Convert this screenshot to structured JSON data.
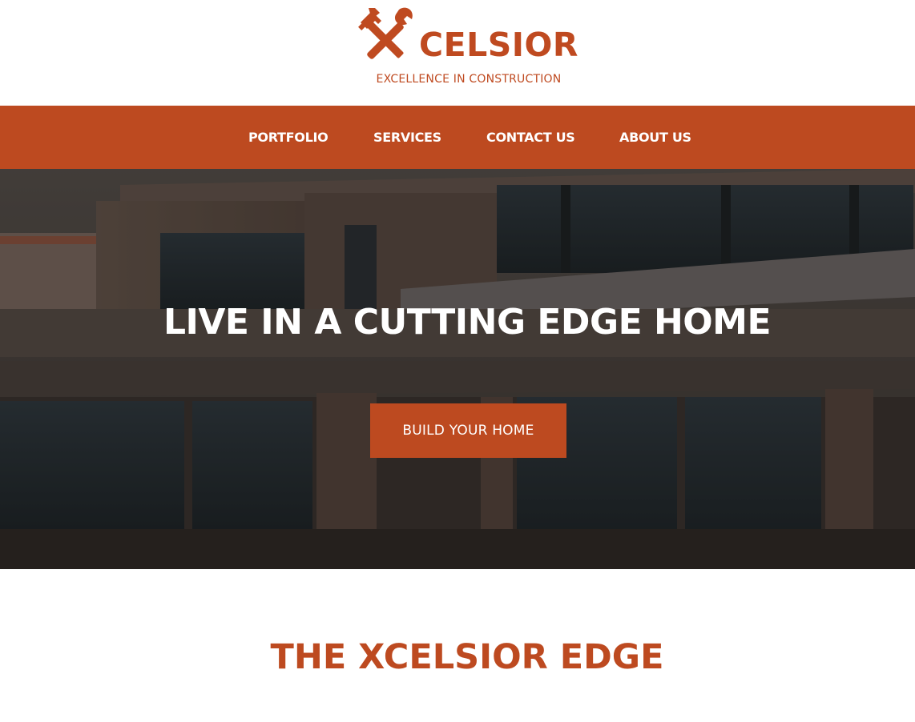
{
  "brand": {
    "logo_text": "CELSIOR",
    "tagline": "EXCELLENCE IN CONSTRUCTION",
    "logo_icon": "hammer-wrench-x-icon",
    "accent_color": "#bd4a20"
  },
  "nav": {
    "items": [
      {
        "label": "PORTFOLIO"
      },
      {
        "label": "SERVICES"
      },
      {
        "label": "CONTACT US"
      },
      {
        "label": "ABOUT US"
      }
    ]
  },
  "hero": {
    "title": "LIVE IN A CUTTING EDGE HOME",
    "button_label": "BUILD YOUR HOME"
  },
  "section": {
    "title": "THE XCELSIOR EDGE"
  }
}
